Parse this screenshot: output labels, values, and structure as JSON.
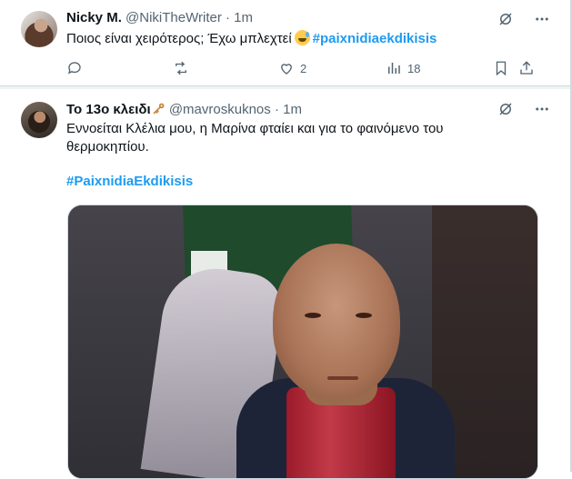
{
  "tweets": [
    {
      "name": "Nicky M.",
      "handle": "@NikiTheWriter",
      "separator": "·",
      "time": "1m",
      "text": "Ποιος είναι χειρότερος; Έχω μπλεχτεί",
      "emoji": "sweat-smile-emoji",
      "hashtag": "#paixnidiaekdikisis",
      "actions": {
        "reply_count": "",
        "retweet_count": "",
        "like_count": "2",
        "views_count": "18"
      }
    },
    {
      "name": "Το 13ο κλειδι",
      "name_icon": "key-icon",
      "handle": "@mavroskuknos",
      "separator": "·",
      "time": "1m",
      "text": "Εννοείται Κλέλια μου, η Μαρίνα φταίει και για το φαινόμενο του θερμοκηπίου.",
      "hashtag": "#PaixnidiaEkdikisis",
      "media": "gif-image-man-in-crowd"
    }
  ],
  "colors": {
    "accent": "#1d9bf0",
    "text": "#0f1419",
    "muted": "#536471",
    "border": "#cfd9de"
  }
}
